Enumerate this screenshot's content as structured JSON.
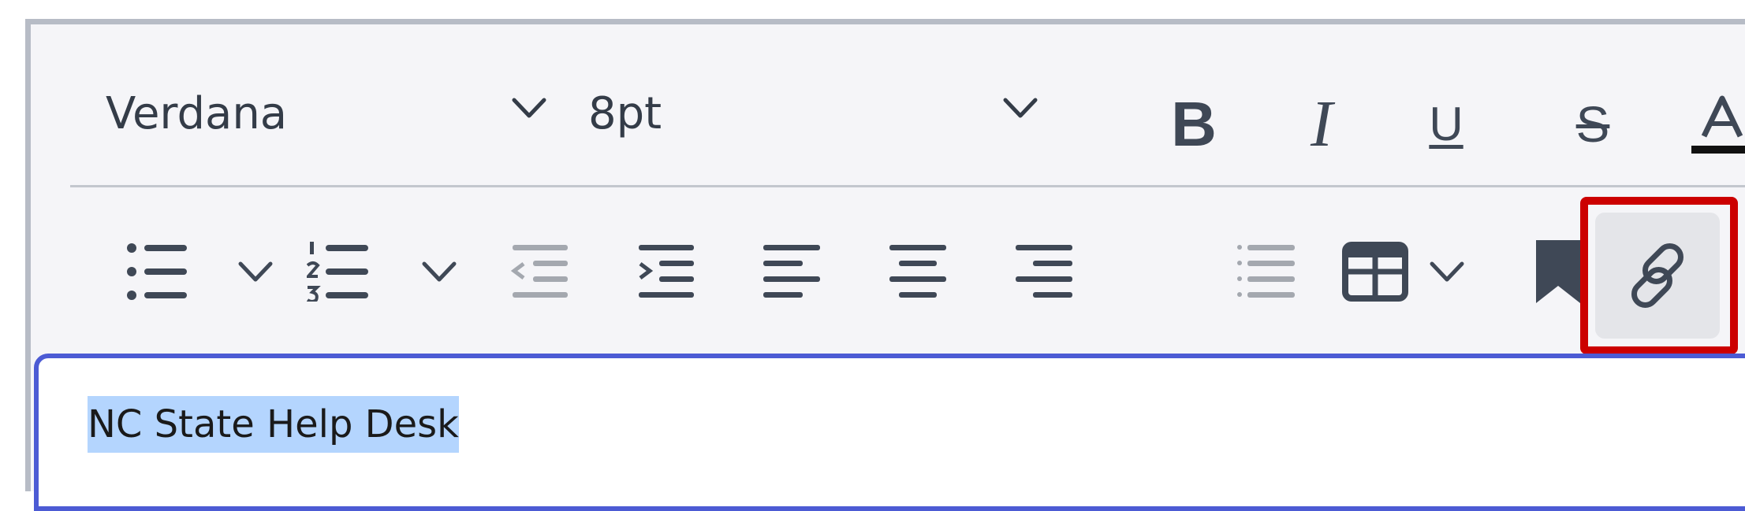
{
  "toolbar": {
    "font_family": {
      "value": "Verdana"
    },
    "font_size": {
      "value": "8pt"
    },
    "format_buttons": [
      {
        "name": "bold-button",
        "glyph": "B"
      },
      {
        "name": "italic-button",
        "glyph": "I"
      },
      {
        "name": "underline-button",
        "glyph": "U"
      },
      {
        "name": "strikethrough-button",
        "glyph": "S"
      },
      {
        "name": "text-color-button",
        "glyph": "A",
        "underline_color": "#111111"
      }
    ],
    "row2_icons": [
      "bullet-list-icon",
      "chevron-down-icon",
      "numbered-list-icon",
      "chevron-down-icon",
      "outdent-icon",
      "indent-icon",
      "align-left-icon",
      "align-center-icon",
      "align-right-icon",
      "line-spacing-icon",
      "table-icon",
      "chevron-down-icon",
      "bookmark-icon",
      "link-icon"
    ],
    "highlight_color": "#cc0000"
  },
  "content": {
    "text": "NC State Help Desk",
    "selection_color": "#b4d5fe",
    "focus_border_color": "#4c5bd4"
  }
}
